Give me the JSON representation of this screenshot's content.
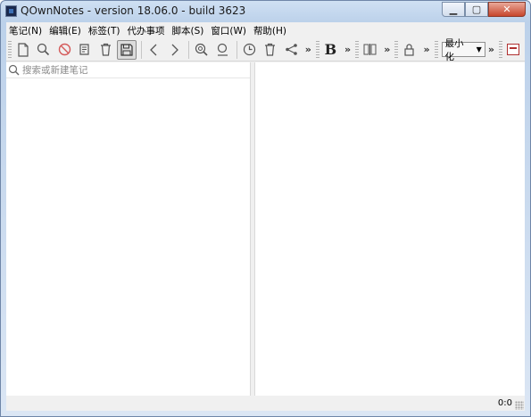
{
  "window": {
    "title": "QOwnNotes - version 18.06.0 - build 3623",
    "minimize_glyph": "▁",
    "maximize_glyph": "▢",
    "close_glyph": "✕"
  },
  "menubar": {
    "items": [
      {
        "label": "笔记(N)"
      },
      {
        "label": "编辑(E)"
      },
      {
        "label": "标签(T)"
      },
      {
        "label": "代办事项"
      },
      {
        "label": "脚本(S)"
      },
      {
        "label": "窗口(W)"
      },
      {
        "label": "帮助(H)"
      }
    ]
  },
  "toolbar": {
    "overflow_glyph": "»",
    "bold_label": "B",
    "workspace_combo": {
      "value": "最小化",
      "arrow": "▼"
    },
    "icons": [
      "new-note-icon",
      "find-icon",
      "no-entry-icon",
      "edit-note-icon",
      "trash-icon",
      "save-icon",
      "back-icon",
      "forward-icon",
      "zoom-search-icon",
      "search-text-icon",
      "history-icon",
      "trash-icon",
      "share-icon",
      "bold-icon",
      "split-view-icon",
      "lock-icon",
      "panel-icon"
    ]
  },
  "search": {
    "placeholder": "搜索或新建笔记"
  },
  "statusbar": {
    "cursor_position": "0:0"
  },
  "colors": {
    "titlebar": "#bcd1ea",
    "close_button": "#c7452c",
    "chrome": "#f0f0f0",
    "accent_red": "#b03030"
  }
}
